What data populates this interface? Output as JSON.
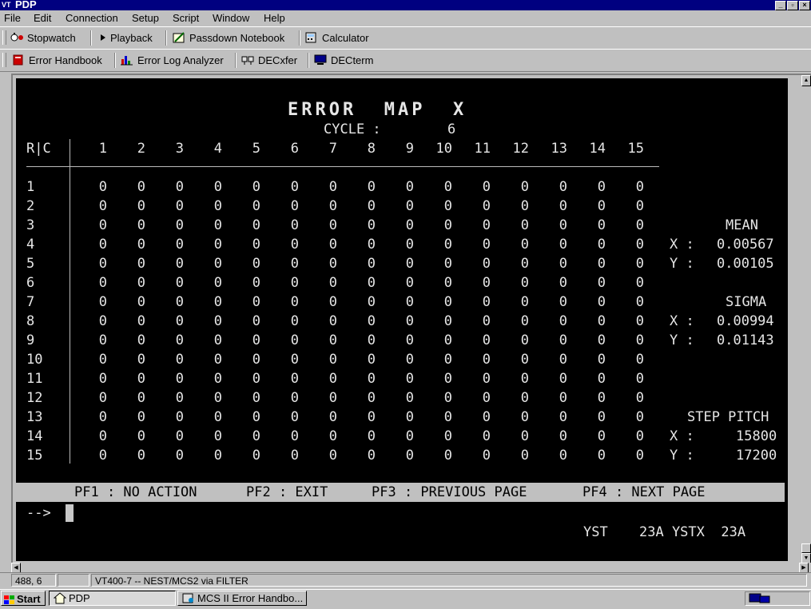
{
  "window": {
    "title": "PDP",
    "app_icon": "VT"
  },
  "menu": [
    "File",
    "Edit",
    "Connection",
    "Setup",
    "Script",
    "Window",
    "Help"
  ],
  "toolbar1": {
    "stopwatch": "Stopwatch",
    "playback": "Playback",
    "passdown": "Passdown Notebook",
    "calculator": "Calculator"
  },
  "toolbar2": {
    "error_handbook": "Error Handbook",
    "error_log": "Error Log Analyzer",
    "decxfer": "DECxfer",
    "decterm": "DECterm"
  },
  "terminal": {
    "title": "ERROR  MAP  X",
    "cycle_label": "CYCLE :",
    "cycle_value": "6",
    "rc_label": "R|C",
    "columns": [
      "1",
      "2",
      "3",
      "4",
      "5",
      "6",
      "7",
      "8",
      "9",
      "10",
      "11",
      "12",
      "13",
      "14",
      "15"
    ],
    "rows": [
      "1",
      "2",
      "3",
      "4",
      "5",
      "6",
      "7",
      "8",
      "9",
      "10",
      "11",
      "12",
      "13",
      "14",
      "15"
    ],
    "cell_value": "0",
    "stats": {
      "mean_label": "MEAN",
      "mean_x_label": "X :",
      "mean_x": "0.00567",
      "mean_y_label": "Y :",
      "mean_y": "0.00105",
      "sigma_label": "SIGMA",
      "sigma_x_label": "X :",
      "sigma_x": "0.00994",
      "sigma_y_label": "Y :",
      "sigma_y": "0.01143",
      "step_label": "STEP PITCH",
      "step_x_label": "X :",
      "step_x": "15800",
      "step_y_label": "Y :",
      "step_y": "17200"
    },
    "pf1": "PF1 : NO ACTION",
    "pf2": "PF2 : EXIT",
    "pf3": "PF3 : PREVIOUS PAGE",
    "pf4": "PF4 : NEXT PAGE",
    "prompt": "-->",
    "footer_left": "YST",
    "footer_right": "23A YSTX  23A"
  },
  "status": {
    "cursor_pos": "488, 6",
    "connection": "VT400-7 -- NEST/MCS2 via FILTER"
  },
  "taskbar": {
    "start": "Start",
    "task1": "PDP",
    "task2": "MCS II Error Handbo..."
  }
}
